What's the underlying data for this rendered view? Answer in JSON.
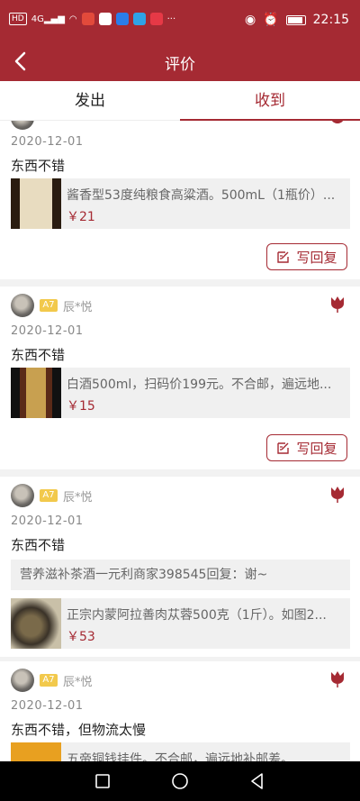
{
  "status_bar": {
    "left": "HD 4G",
    "time": "22:15"
  },
  "navbar": {
    "title": "评价",
    "back_icon": "chevron-left-icon"
  },
  "tabs": [
    {
      "label": "发出",
      "active": false
    },
    {
      "label": "收到",
      "active": true
    }
  ],
  "colors": {
    "brand": "#a52a33",
    "price": "#a52a33",
    "level_badge": "#f2c94c"
  },
  "reviews": [
    {
      "date": "2020-12-01",
      "comment": "东西不错",
      "product": {
        "name": "酱香型53度纯粮食高粱酒。500mL（1瓶价）...",
        "price": "￥21"
      },
      "reply_label": "写回复"
    },
    {
      "user": "辰*悦",
      "level": "A7",
      "date": "2020-12-01",
      "comment": "东西不错",
      "product": {
        "name": "白酒500ml，扫码价199元。不合邮，遍远地...",
        "price": "￥15"
      },
      "reply_label": "写回复"
    },
    {
      "user": "辰*悦",
      "level": "A7",
      "date": "2020-12-01",
      "comment": "东西不错",
      "reply_quote": "营养滋补茶酒一元利商家398545回复：谢~",
      "product": {
        "name": "正宗内蒙阿拉善肉苁蓉500克（1斤）。如图2...",
        "price": "￥53"
      }
    },
    {
      "user": "辰*悦",
      "level": "A7",
      "date": "2020-12-01",
      "comment": "东西不错，但物流太慢",
      "product": {
        "name": "五帝铜钱挂件。不合邮，遍远地补邮差。"
      }
    }
  ]
}
